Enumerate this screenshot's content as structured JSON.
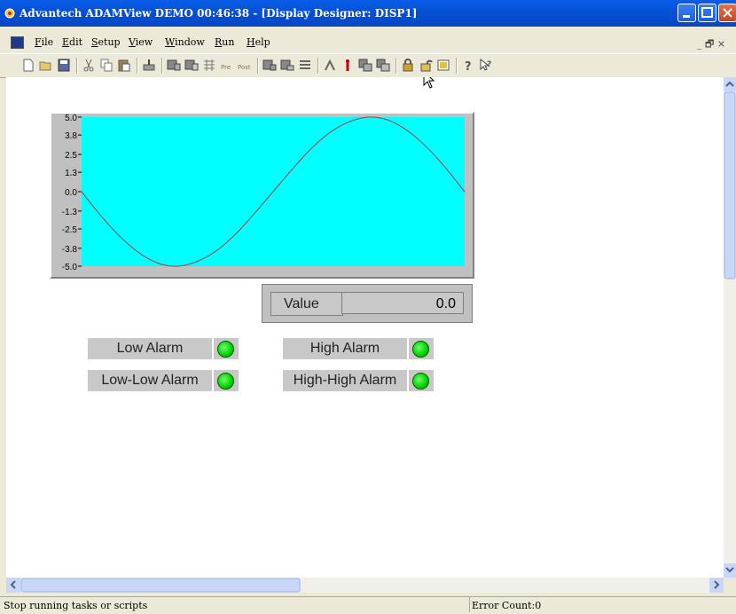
{
  "window": {
    "title": "Advantech ADAMView DEMO 00:46:38 - [Display Designer: DISP1]"
  },
  "menu": [
    {
      "key": "F",
      "rest": "ile"
    },
    {
      "key": "E",
      "rest": "dit"
    },
    {
      "key": "S",
      "rest": "etup"
    },
    {
      "key": "V",
      "rest": "iew"
    },
    {
      "key": "W",
      "rest": "indow"
    },
    {
      "key": "R",
      "rest": "un"
    },
    {
      "key": "H",
      "rest": "elp"
    }
  ],
  "mdi_controls": "_ 🗗 ×",
  "toolbar_icons": [
    "new-icon",
    "open-icon",
    "save-icon",
    "cut-icon",
    "copy-icon",
    "paste-icon",
    "task-icon",
    "display-icon",
    "display-designer-icon",
    "grid-icon",
    "pre-icon",
    "post-icon",
    "run-display-icon",
    "run-task-icon",
    "run-all-icon",
    "step-icon",
    "stop-icon",
    "tool-a-icon",
    "tool-b-icon",
    "lock-icon",
    "unlock-icon",
    "window-icon",
    "help-icon",
    "context-help-icon"
  ],
  "chart_data": {
    "type": "line",
    "title": "",
    "xlabel": "",
    "ylabel": "",
    "ylim": [
      -5.0,
      5.0
    ],
    "y_ticks": [
      "5.0",
      "3.8",
      "2.5",
      "1.3",
      "0.0",
      "-1.3",
      "-2.5",
      "-3.8",
      "-5.0"
    ],
    "series": [
      {
        "color": "#a04040",
        "x": [
          0,
          0.05,
          0.1,
          0.15,
          0.2,
          0.25,
          0.3,
          0.35,
          0.4,
          0.45,
          0.5,
          0.55,
          0.6,
          0.65,
          0.7,
          0.75,
          0.8,
          0.85,
          0.9,
          0.95,
          1.0
        ],
        "y": [
          0.0,
          -1.6,
          -3.0,
          -4.1,
          -4.8,
          -5.0,
          -4.7,
          -4.0,
          -2.9,
          -1.5,
          0.0,
          1.5,
          2.9,
          4.0,
          4.7,
          5.0,
          4.8,
          4.1,
          3.0,
          1.6,
          0.0
        ]
      }
    ],
    "plot_bg": "#00ffff"
  },
  "value_display": {
    "label": "Value",
    "value": "0.0"
  },
  "alarms": [
    {
      "label": "Low Alarm",
      "state": "normal"
    },
    {
      "label": "High Alarm",
      "state": "normal"
    },
    {
      "label": "Low-Low Alarm",
      "state": "normal"
    },
    {
      "label": "High-High Alarm",
      "state": "normal"
    }
  ],
  "status": {
    "message": "Stop running tasks or scripts",
    "error_count": "Error Count:0"
  }
}
